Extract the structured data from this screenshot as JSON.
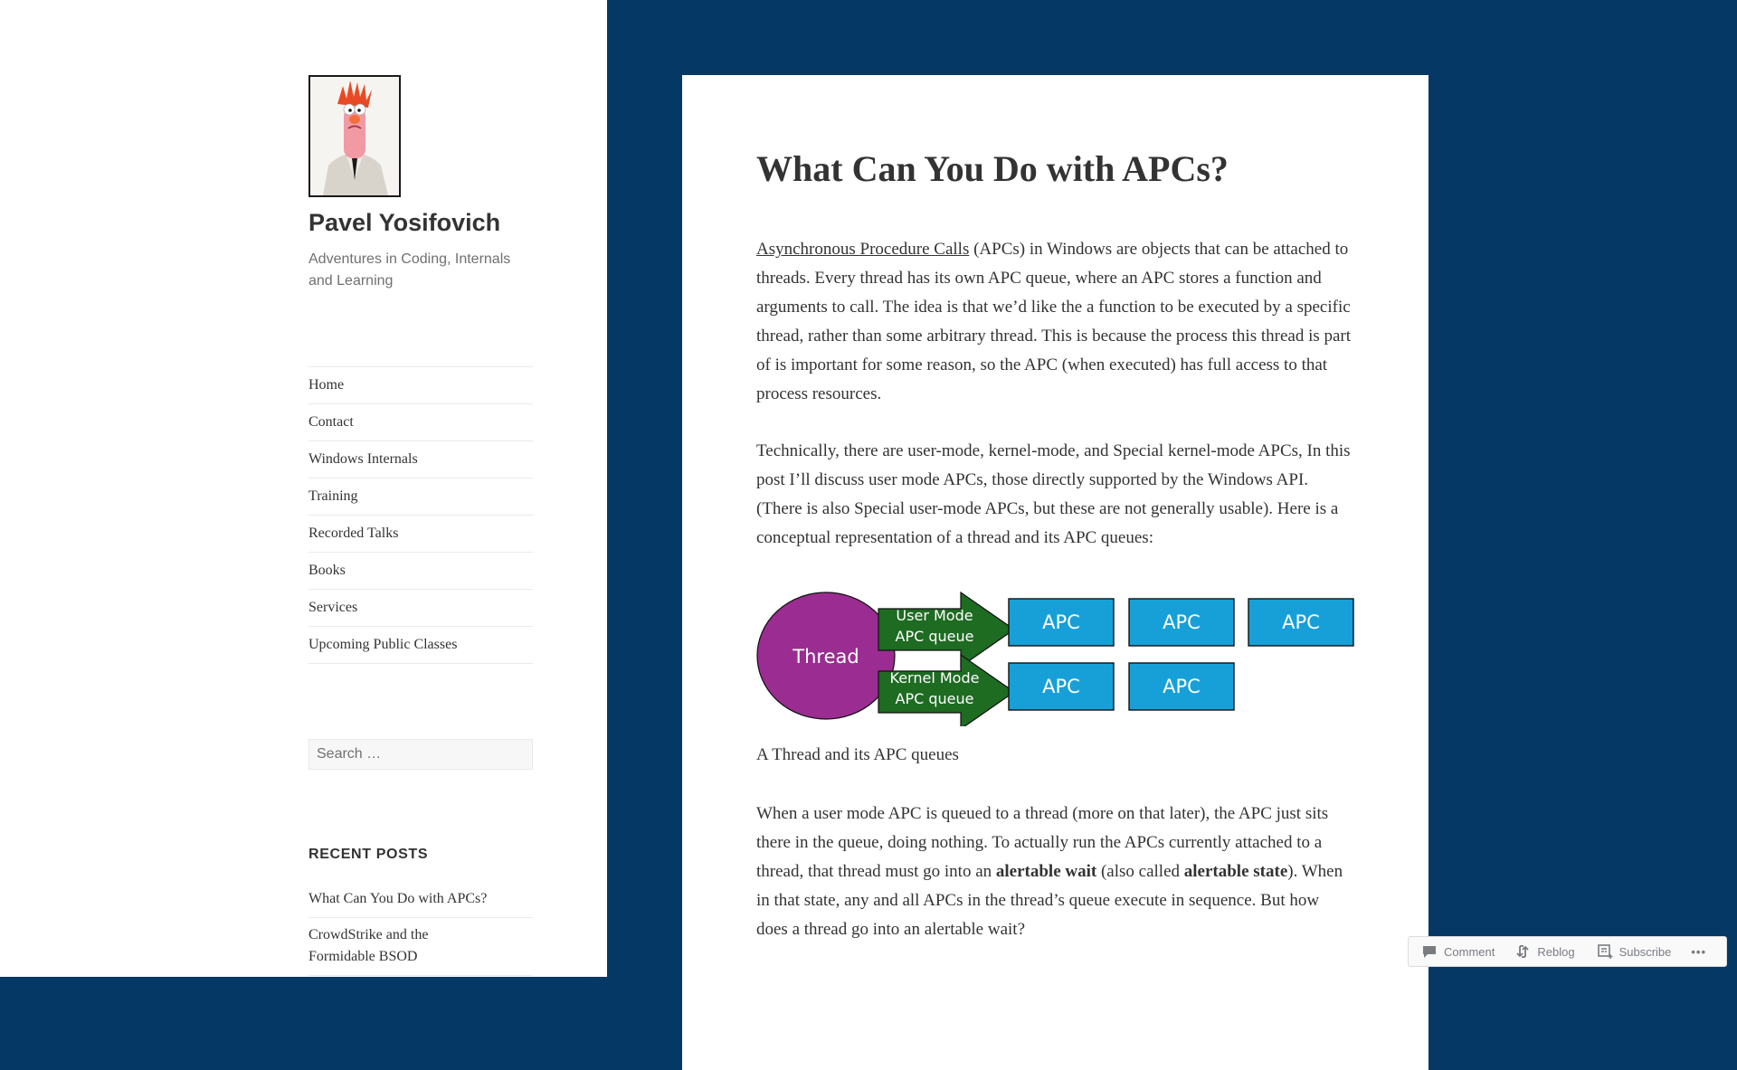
{
  "site": {
    "title": "Pavel Yosifovich",
    "description": "Adventures in Coding, Internals and Learning",
    "avatar_alt": "avatar-photo"
  },
  "nav": {
    "items": [
      {
        "label": "Home"
      },
      {
        "label": "Contact"
      },
      {
        "label": "Windows Internals"
      },
      {
        "label": "Training"
      },
      {
        "label": "Recorded Talks"
      },
      {
        "label": "Books"
      },
      {
        "label": "Services"
      },
      {
        "label": "Upcoming Public Classes"
      }
    ]
  },
  "search": {
    "placeholder": "Search …",
    "value": ""
  },
  "recent_posts": {
    "title": "RECENT POSTS",
    "items": [
      {
        "label": "What Can You Do with APCs?"
      },
      {
        "label": "CrowdStrike and the Formidable BSOD"
      }
    ]
  },
  "post": {
    "title": "What Can You Do with APCs?",
    "p1_link": "Asynchronous Procedure Calls",
    "p1_rest": " (APCs) in Windows are objects that can be attached to threads. Every thread has its own APC queue, where an APC stores a function and arguments to call. The idea is that we’d like the a function to be executed by a specific thread, rather than some arbitrary thread. This is because the process this thread is part of is important for some reason, so the APC (when executed) has full access to that process resources.",
    "p2": "Technically, there are user-mode, kernel-mode, and Special kernel-mode APCs, In this post I’ll discuss user mode APCs, those directly supported by the Windows API. (There is also Special user-mode APCs, but these are not generally usable). Here is a conceptual representation of a thread and its APC queues:",
    "figure": {
      "thread_label": "Thread",
      "user_queue_line1": "User Mode",
      "user_queue_line2": "APC queue",
      "kernel_queue_line1": "Kernel Mode",
      "kernel_queue_line2": "APC queue",
      "user_apcs": [
        "APC",
        "APC",
        "APC"
      ],
      "kernel_apcs": [
        "APC",
        "APC"
      ],
      "colors": {
        "thread": "#9b2c91",
        "queue": "#1e6b22",
        "apc": "#17a0d8"
      }
    },
    "caption": "A Thread and its APC queues",
    "p3_a": "When a user mode APC is queued to a thread (more on that later), the APC just sits there in the queue, doing nothing. To actually run the APCs currently attached to a thread, that thread must go into an ",
    "p3_b1": "alertable wait",
    "p3_c": " (also called ",
    "p3_b2": "alertable state",
    "p3_d": "). When in that state, any and all APCs in the thread’s queue execute in sequence. But how does a thread go into an alertable wait?"
  },
  "action_bar": {
    "comment": "Comment",
    "reblog": "Reblog",
    "subscribe": "Subscribe",
    "more": "•••"
  },
  "colors": {
    "background": "#053865",
    "sidebar": "#ffffff",
    "text": "#333333",
    "muted": "#707070"
  }
}
